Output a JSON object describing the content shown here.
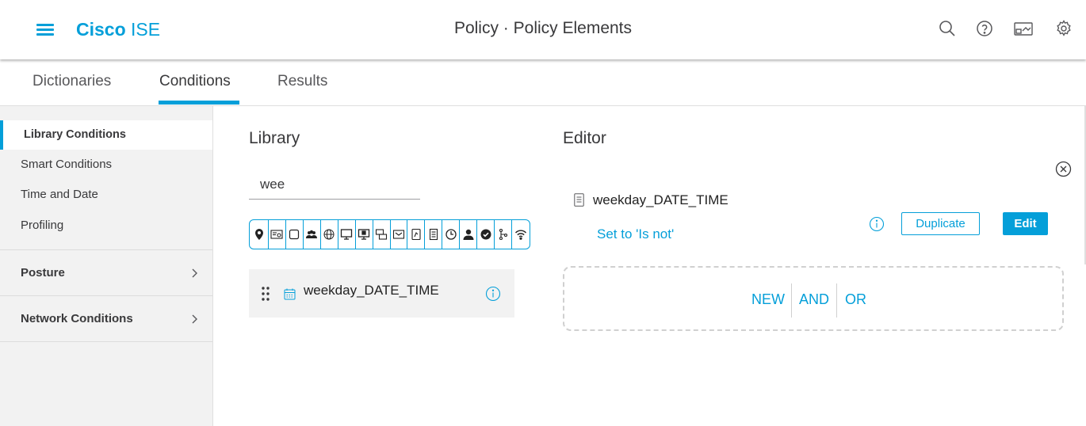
{
  "header": {
    "brand_bold": "Cisco",
    "brand_light": "ISE",
    "title": "Policy · Policy Elements",
    "icons": [
      "menu-icon",
      "search-icon",
      "help-icon",
      "dashboard-icon",
      "settings-icon"
    ]
  },
  "tabs": [
    {
      "label": "Dictionaries",
      "active": false
    },
    {
      "label": "Conditions",
      "active": true
    },
    {
      "label": "Results",
      "active": false
    }
  ],
  "sidebar": {
    "items": [
      {
        "label": "Library Conditions",
        "active": true
      },
      {
        "label": "Smart Conditions"
      },
      {
        "label": "Time and Date"
      },
      {
        "label": "Profiling"
      },
      {
        "label": "Posture",
        "expandable": true
      },
      {
        "label": "Network Conditions",
        "expandable": true
      }
    ]
  },
  "library": {
    "title": "Library",
    "search_value": "wee",
    "filter_icons": [
      "location-pin-icon",
      "id-card-icon",
      "blank-square-icon",
      "user-group-icon",
      "globe-icon",
      "monitor-icon",
      "desktop-icon",
      "chat-icon",
      "device-icon",
      "mobile-icon",
      "document-icon",
      "clock-icon",
      "user-icon",
      "check-circle-icon",
      "network-tree-icon",
      "wifi-icon"
    ],
    "items": [
      {
        "name": "weekday_DATE_TIME",
        "icon": "calendar-icon"
      }
    ]
  },
  "editor": {
    "title": "Editor",
    "condition_name": "weekday_DATE_TIME",
    "set_not_label": "Set to 'Is not'",
    "duplicate_label": "Duplicate",
    "edit_label": "Edit",
    "ops": {
      "new": "NEW",
      "and": "AND",
      "or": "OR"
    }
  },
  "colors": {
    "accent": "#049fd9",
    "text": "#39393b",
    "sidebar_bg": "#f2f2f2"
  }
}
